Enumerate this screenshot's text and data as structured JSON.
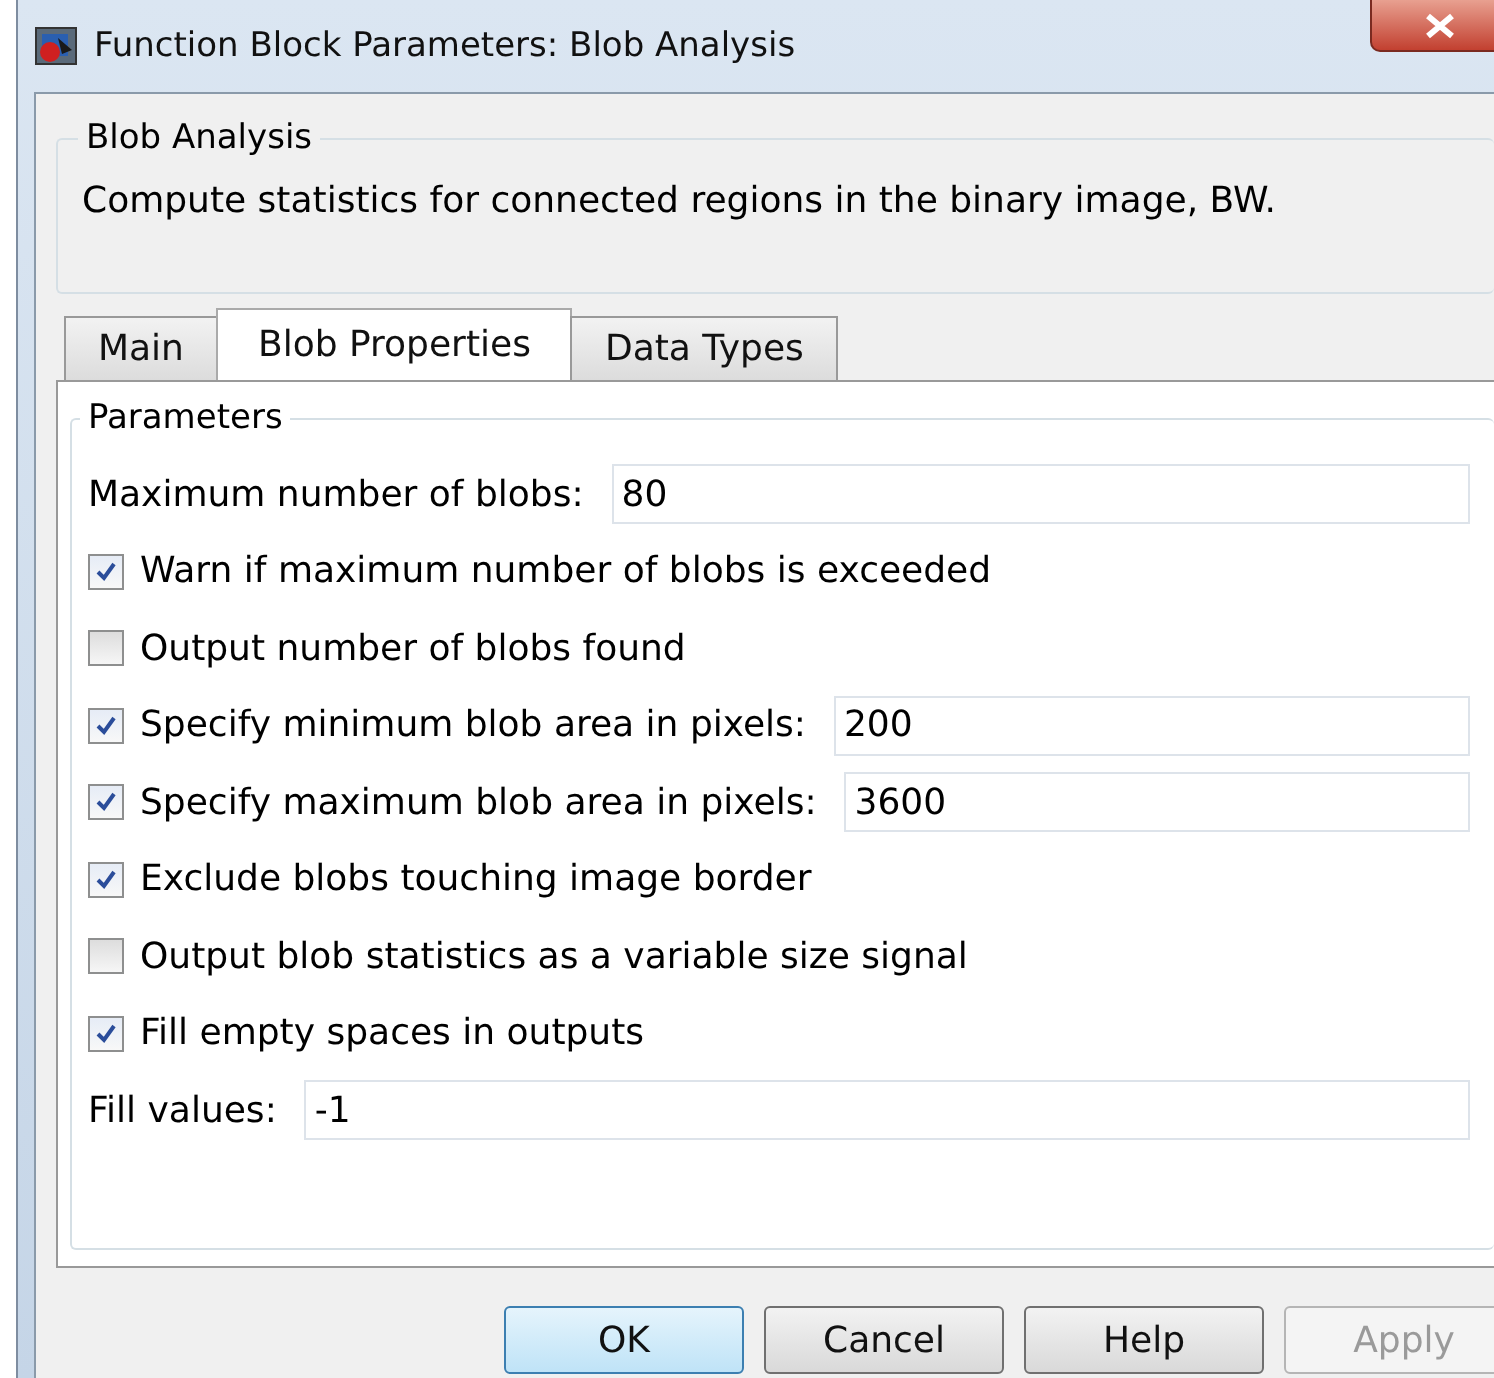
{
  "window": {
    "title": "Function Block Parameters: Blob Analysis"
  },
  "description": {
    "heading": "Blob Analysis",
    "text": "Compute statistics for connected regions in the binary image, BW."
  },
  "tabs": [
    {
      "label": "Main",
      "selected": false
    },
    {
      "label": "Blob Properties",
      "selected": true
    },
    {
      "label": "Data Types",
      "selected": false
    }
  ],
  "parameters": {
    "heading": "Parameters",
    "rows": [
      {
        "kind": "field",
        "label": "Maximum number of blobs:",
        "value": "80"
      },
      {
        "kind": "checkbox",
        "label": "Warn if maximum number of blobs is exceeded",
        "checked": true
      },
      {
        "kind": "checkbox",
        "label": "Output number of blobs found",
        "checked": false
      },
      {
        "kind": "checkbox_field",
        "label": "Specify minimum blob area in pixels:",
        "checked": true,
        "value": "200"
      },
      {
        "kind": "checkbox_field",
        "label": "Specify maximum blob area in pixels:",
        "checked": true,
        "value": "3600"
      },
      {
        "kind": "checkbox",
        "label": "Exclude blobs touching image border",
        "checked": true
      },
      {
        "kind": "checkbox",
        "label": "Output blob statistics as a variable size signal",
        "checked": false
      },
      {
        "kind": "checkbox",
        "label": "Fill empty spaces in outputs",
        "checked": true
      },
      {
        "kind": "field",
        "label": "Fill values:",
        "value": "-1"
      }
    ]
  },
  "buttons": [
    {
      "label": "OK",
      "disabled": false,
      "default": true
    },
    {
      "label": "Cancel",
      "disabled": false,
      "default": false
    },
    {
      "label": "Help",
      "disabled": false,
      "default": false
    },
    {
      "label": "Apply",
      "disabled": true,
      "default": false
    }
  ]
}
